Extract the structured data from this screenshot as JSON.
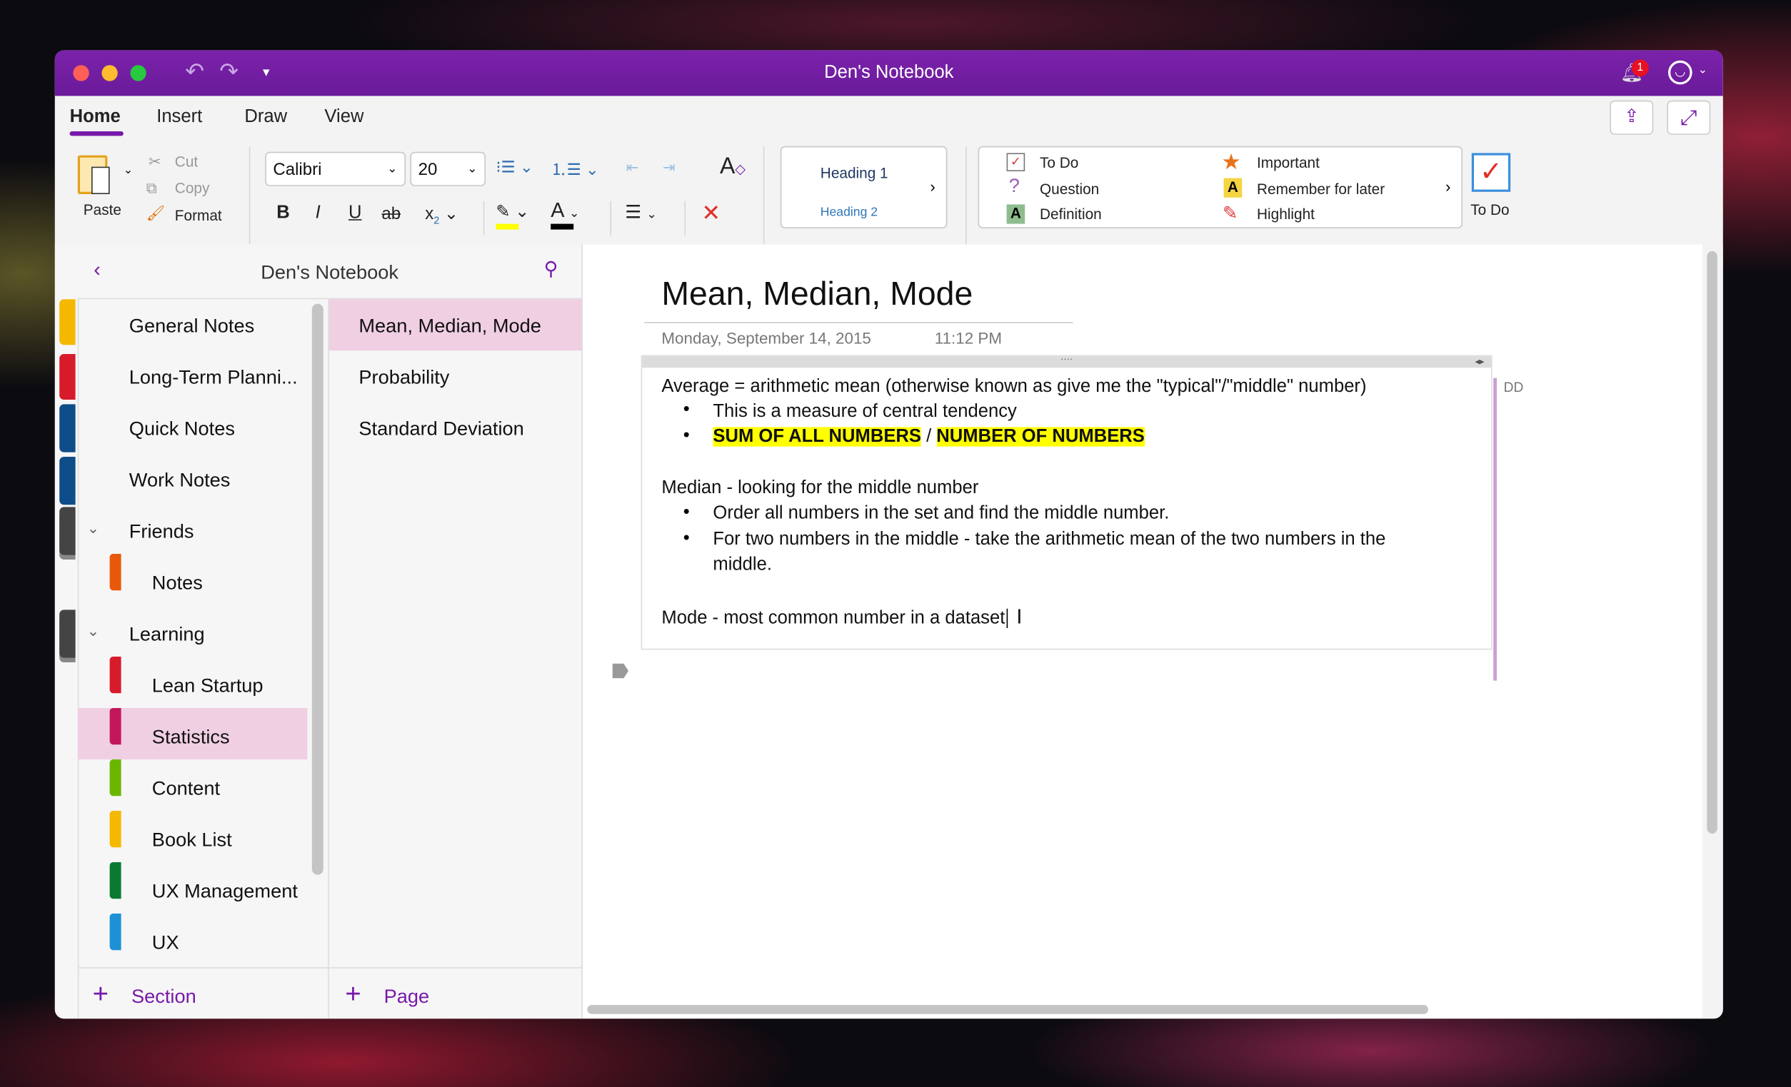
{
  "window": {
    "title": "Den's Notebook",
    "notification_count": "1"
  },
  "ribbon": {
    "tabs": [
      {
        "label": "Home",
        "active": true
      },
      {
        "label": "Insert"
      },
      {
        "label": "Draw"
      },
      {
        "label": "View"
      }
    ],
    "clipboard": {
      "paste": "Paste",
      "cut": "Cut",
      "copy": "Copy",
      "format": "Format"
    },
    "font": {
      "family": "Calibri",
      "size": "20"
    },
    "styles": {
      "heading1": "Heading 1",
      "heading2": "Heading 2"
    },
    "tags": [
      {
        "label": "To Do",
        "icon": "checkbox-icon"
      },
      {
        "label": "Question",
        "icon": "question-icon"
      },
      {
        "label": "Definition",
        "icon": "definition-icon"
      },
      {
        "label": "Important",
        "icon": "star-icon"
      },
      {
        "label": "Remember for later",
        "icon": "remember-icon"
      },
      {
        "label": "Highlight",
        "icon": "highlighter-icon"
      }
    ],
    "todo_button": "To Do"
  },
  "navigation": {
    "notebook_title": "Den's Notebook",
    "sections": [
      {
        "label": "General Notes"
      },
      {
        "label": "Long-Term Planni..."
      },
      {
        "label": "Quick Notes"
      },
      {
        "label": "Work Notes"
      },
      {
        "label": "Friends",
        "group": true
      },
      {
        "label": "Notes",
        "color": "#e8590c"
      },
      {
        "label": "Learning",
        "group": true
      },
      {
        "label": "Lean Startup",
        "color": "#d81b2a"
      },
      {
        "label": "Statistics",
        "color": "#c2185b",
        "selected": true
      },
      {
        "label": "Content",
        "color": "#6bb700"
      },
      {
        "label": "Book List",
        "color": "#f5b800"
      },
      {
        "label": "UX Management",
        "color": "#0a7a33"
      },
      {
        "label": "UX",
        "color": "#1e90d6"
      }
    ],
    "pages": [
      {
        "label": "Mean, Median, Mode",
        "selected": true
      },
      {
        "label": "Probability"
      },
      {
        "label": "Standard Deviation"
      }
    ],
    "add_section": "Section",
    "add_page": "Page"
  },
  "note": {
    "title": "Mean, Median, Mode",
    "date": "Monday, September 14, 2015",
    "time": "11:12 PM",
    "author_initials": "DD",
    "lines": {
      "average": "Average = arithmetic mean (otherwise known as give me the \"typical\"/\"middle\" number)",
      "average_b1": "This is a measure of central tendency",
      "average_b2a": "SUM OF ALL NUMBERS",
      "average_b2sep": " / ",
      "average_b2b": "NUMBER OF NUMBERS",
      "median": "Median - looking for the middle number",
      "median_b1": "Order all numbers in the set and find the middle number.",
      "median_b2": "For two numbers in the middle - take the arithmetic mean of the two numbers in the",
      "median_b2_cont": "middle.",
      "mode": "Mode - most common number in a dataset"
    }
  },
  "colors": {
    "accent": "#7719aa",
    "selection": "#f0cfe3",
    "highlight": "#ffff00"
  }
}
